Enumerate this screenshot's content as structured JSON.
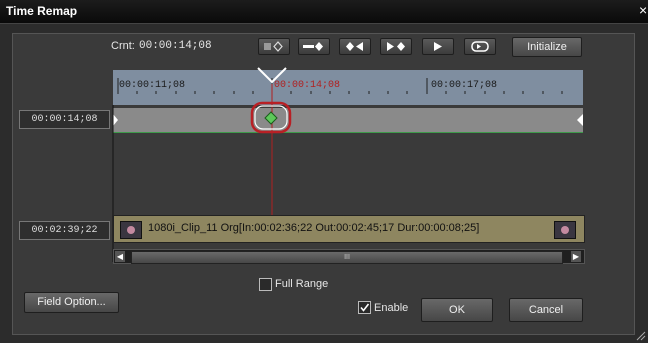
{
  "window": {
    "title": "Time Remap",
    "close_glyph": "×"
  },
  "header": {
    "current_label": "Crnt:",
    "current_time": "00:00:14;08",
    "initialize_label": "Initialize"
  },
  "transport_icons": [
    "add-keyframe-icon",
    "delete-keyframe-icon",
    "prev-keyframe-icon",
    "next-keyframe-icon",
    "play-icon",
    "loop-icon"
  ],
  "ruler": {
    "labels": [
      "00:00:11;08",
      "00:00:14;08",
      "00:00:17;08"
    ]
  },
  "timecodes": {
    "top": "00:00:14;08",
    "bottom": "00:02:39;22"
  },
  "clip": {
    "text": "1080i_Clip_11  Org[In:00:02:36;22 Out:00:02:45;17 Dur:00:00:08;25]"
  },
  "scrollbar": {
    "center_glyph": "III"
  },
  "options": {
    "full_range_label": "Full Range",
    "full_range_checked": false,
    "enable_label": "Enable",
    "enable_checked": true
  },
  "buttons": {
    "field_option": "Field Option...",
    "ok": "OK",
    "cancel": "Cancel"
  },
  "colors": {
    "playhead": "#b02020",
    "keyframe": "#5dc85a",
    "ruler": "#7f8ea0",
    "clip": "#8e8660"
  }
}
